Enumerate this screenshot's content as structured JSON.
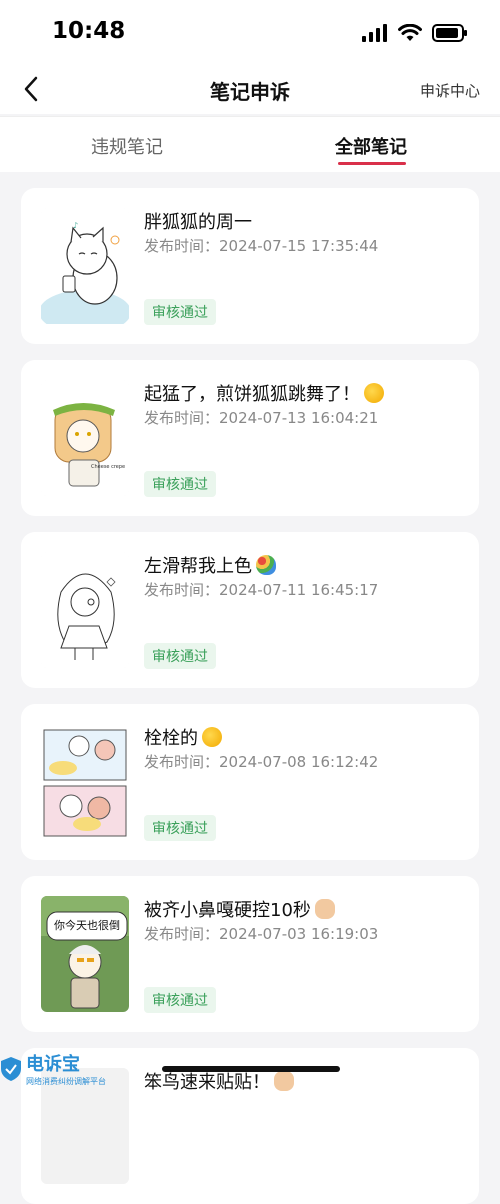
{
  "status": {
    "time": "10:48"
  },
  "nav": {
    "title": "笔记申诉",
    "right_link": "申诉中心"
  },
  "tabs": [
    {
      "label": "违规笔记",
      "active": false
    },
    {
      "label": "全部笔记",
      "active": true
    }
  ],
  "time_prefix": "发布时间：",
  "notes": [
    {
      "title": "胖狐狐的周一",
      "time": "2024-07-15 17:35:44",
      "status": "审核通过",
      "emoji": ""
    },
    {
      "title": "起猛了，煎饼狐狐跳舞了！",
      "time": "2024-07-13 16:04:21",
      "status": "审核通过",
      "emoji": "zany-face"
    },
    {
      "title": "左滑帮我上色",
      "time": "2024-07-11 16:45:17",
      "status": "审核通过",
      "emoji": "palette"
    },
    {
      "title": "栓栓的",
      "time": "2024-07-08 16:12:42",
      "status": "审核通过",
      "emoji": "zany-face"
    },
    {
      "title": "被齐小鼻嘎硬控10秒",
      "time": "2024-07-03 16:19:03",
      "status": "审核通过",
      "emoji": "fist"
    },
    {
      "title": "笨鸟速来贴贴！",
      "time": "",
      "status": "",
      "emoji": "fist"
    }
  ],
  "thumb_text": {
    "card5_bubble": "你今天也很倒"
  },
  "watermark": {
    "title": "电诉宝",
    "subtitle": "网络消费纠纷调解平台"
  },
  "colors": {
    "accent": "#d9304a",
    "approved_text": "#3aa05a",
    "approved_bg": "#eaf6ed"
  }
}
